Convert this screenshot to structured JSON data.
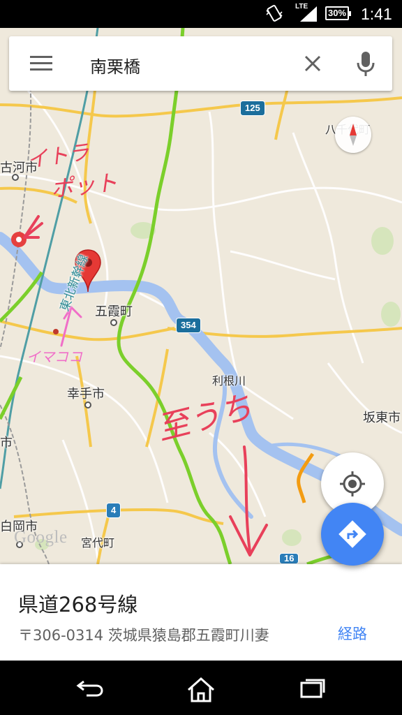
{
  "status_bar": {
    "network": "LTE",
    "battery": "30%",
    "time": "1:41"
  },
  "search": {
    "query": "南栗橋"
  },
  "map": {
    "places": {
      "koga": "古河市",
      "goka": "五霞町",
      "satte": "幸手市",
      "bando": "坂東市",
      "miyashiro": "宮代町",
      "shiraoka": "白岡市",
      "hassen": "八千代町",
      "edge_left": "市"
    },
    "river": "利根川",
    "rail": "東北新幹線",
    "routes": {
      "r125": "125",
      "r354": "354",
      "r4": "4",
      "r16": "16"
    },
    "attribution": "Google",
    "handwriting": {
      "note1": "イトラ",
      "note2": "ポット",
      "note3": "イマココ",
      "note4": "至うち"
    }
  },
  "place_card": {
    "title": "県道268号線",
    "address": "〒306-0314 茨城県猿島郡五霞町川妻",
    "route_button": "経路"
  },
  "colors": {
    "map_background": "#efe9dc",
    "water": "#a4c2f0",
    "traffic_green": "#7bcf2b",
    "traffic_orange": "#f39c12",
    "annotation_red": "#e8405a",
    "annotation_pink": "#f06ec8",
    "accent_blue": "#4285f4"
  },
  "icons": {
    "menu": "menu-icon",
    "clear": "close-icon",
    "mic": "microphone-icon",
    "compass": "compass-icon",
    "location": "my-location-icon",
    "directions": "directions-icon",
    "pin": "map-pin-icon",
    "back": "back-icon",
    "home": "home-icon",
    "recents": "recents-icon"
  }
}
